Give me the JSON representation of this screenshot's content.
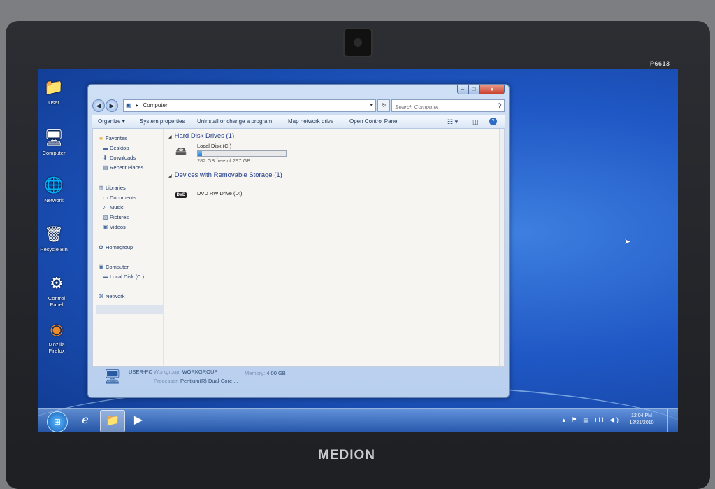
{
  "device": {
    "model": "P6613",
    "brand": "MEDION"
  },
  "desktop": {
    "icons": [
      {
        "label": "User",
        "icon": "user-folder-icon"
      },
      {
        "label": "Computer",
        "icon": "computer-icon"
      },
      {
        "label": "Network",
        "icon": "network-globe-icon"
      },
      {
        "label": "Recycle Bin",
        "icon": "recycle-bin-icon"
      },
      {
        "label": "Control Panel",
        "icon": "control-panel-icon"
      },
      {
        "label": "Mozilla Firefox",
        "icon": "firefox-icon"
      }
    ]
  },
  "window": {
    "caption": {
      "min": "–",
      "max": "□",
      "close": "x"
    },
    "nav": {
      "back": "◀",
      "forward": "▶"
    },
    "address": {
      "path": "Computer",
      "sep": "▸",
      "dropdown": "▾",
      "refresh": "↻"
    },
    "search": {
      "placeholder": "Search Computer",
      "icon": "search-icon",
      "glyph": "⚲"
    },
    "toolbar": {
      "organize": "Organize",
      "system_properties": "System properties",
      "uninstall": "Uninstall or change a program",
      "map_drive": "Map network drive",
      "open_control_panel": "Open Control Panel",
      "view_glyph": "☷ ▾",
      "pane_glyph": "◫",
      "help_glyph": "?"
    },
    "navpane": {
      "favorites": "Favorites",
      "desktop": "Desktop",
      "downloads": "Downloads",
      "recent_places": "Recent Places",
      "libraries": "Libraries",
      "documents": "Documents",
      "music": "Music",
      "pictures": "Pictures",
      "videos": "Videos",
      "homegroup": "Homegroup",
      "computer": "Computer",
      "local_disk": "Local Disk (C:)",
      "network": "Network"
    },
    "main": {
      "hdd_group": "Hard Disk Drives (1)",
      "local_disk_label": "Local Disk (C:)",
      "local_disk_free": "282 GB free of 297 GB",
      "local_disk_used_fraction": 0.05,
      "removable_group": "Devices with Removable Storage (1)",
      "dvd_label": "DVD RW Drive (D:)",
      "dvd_badge": "DVD"
    },
    "details": {
      "pc_name": "USER-PC",
      "workgroup_key": "Workgroup:",
      "workgroup_val": "WORKGROUP",
      "memory_key": "Memory:",
      "memory_val": "4.00 GB",
      "processor_key": "Processor:",
      "processor_val": "Pentium(R) Dual-Core ..."
    }
  },
  "taskbar": {
    "start_glyph": "⊞",
    "tray_glyphs": "▴ ⚑ ▤ ıll ◀)",
    "time": "12:04 PM",
    "date": "12/21/2010"
  },
  "colors": {
    "accent": "#1f57c4",
    "window_frame": "#b8cfee"
  }
}
